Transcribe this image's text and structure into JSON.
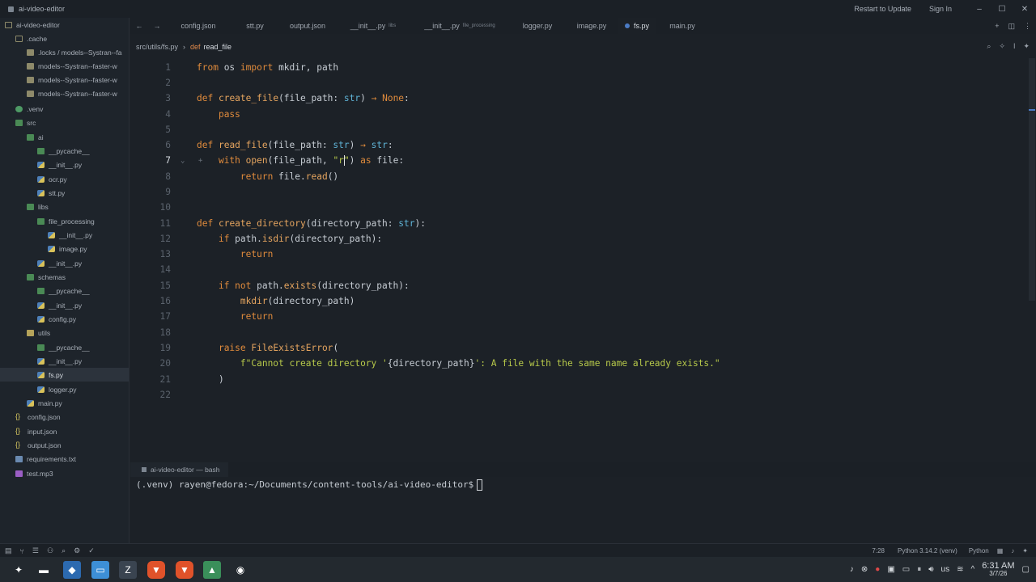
{
  "titlebar": {
    "project": "ai-video-editor",
    "restart": "Restart to Update",
    "signin": "Sign In",
    "minimize": "–",
    "maximize": "☐",
    "close": "✕"
  },
  "sidebar": {
    "root": "ai-video-editor",
    "items": [
      {
        "label": ".cache",
        "icon": "folder-open"
      },
      {
        "label": ".locks / models--Systran--fa",
        "icon": "folder"
      },
      {
        "label": "models--Systran--faster-w",
        "icon": "folder"
      },
      {
        "label": "models--Systran--faster-w",
        "icon": "folder"
      },
      {
        "label": "models--Systran--faster-w",
        "icon": "folder"
      },
      {
        "label": ".venv",
        "icon": "venv"
      },
      {
        "label": "src",
        "icon": "folder-green"
      },
      {
        "label": "ai",
        "icon": "folder-green"
      },
      {
        "label": "__pycache__",
        "icon": "folder-green"
      },
      {
        "label": "__init__.py",
        "icon": "py"
      },
      {
        "label": "ocr.py",
        "icon": "py"
      },
      {
        "label": "stt.py",
        "icon": "py"
      },
      {
        "label": "libs",
        "icon": "folder-green"
      },
      {
        "label": "file_processing",
        "icon": "folder-green"
      },
      {
        "label": "__init__.py",
        "icon": "py"
      },
      {
        "label": "image.py",
        "icon": "py"
      },
      {
        "label": "__init__.py",
        "icon": "py"
      },
      {
        "label": "schemas",
        "icon": "folder-green"
      },
      {
        "label": "__pycache__",
        "icon": "folder-green"
      },
      {
        "label": "__init__.py",
        "icon": "py"
      },
      {
        "label": "config.py",
        "icon": "py"
      },
      {
        "label": "utils",
        "icon": "folder-yellow"
      },
      {
        "label": "__pycache__",
        "icon": "folder-green"
      },
      {
        "label": "__init__.py",
        "icon": "py"
      },
      {
        "label": "fs.py",
        "icon": "py"
      },
      {
        "label": "logger.py",
        "icon": "py"
      },
      {
        "label": "main.py",
        "icon": "py"
      },
      {
        "label": "config.json",
        "icon": "json"
      },
      {
        "label": "input.json",
        "icon": "json"
      },
      {
        "label": "output.json",
        "icon": "json"
      },
      {
        "label": "requirements.txt",
        "icon": "txt"
      },
      {
        "label": "test.mp3",
        "icon": "mp3"
      }
    ]
  },
  "tabs": [
    {
      "label": "config.json",
      "sub": ""
    },
    {
      "label": "stt.py",
      "sub": ""
    },
    {
      "label": "output.json",
      "sub": ""
    },
    {
      "label": "__init__.py",
      "sub": "libs"
    },
    {
      "label": "__init__.py",
      "sub": "file_processing"
    },
    {
      "label": "logger.py",
      "sub": ""
    },
    {
      "label": "image.py",
      "sub": ""
    },
    {
      "label": "fs.py",
      "sub": ""
    },
    {
      "label": "main.py",
      "sub": ""
    }
  ],
  "breadcrumb": {
    "path": "src/utils/fs.py",
    "kw": "def",
    "fn": "read_file"
  },
  "editor": {
    "lines": [
      "1",
      "2",
      "3",
      "4",
      "5",
      "6",
      "7",
      "8",
      "9",
      "10",
      "11",
      "12",
      "13",
      "14",
      "15",
      "16",
      "17",
      "18",
      "19",
      "20",
      "21",
      "22"
    ]
  },
  "terminal": {
    "tab": "ai-video-editor — bash",
    "prompt": "(.venv) rayen@fedora:~/Documents/content-tools/ai-video-editor$"
  },
  "status": {
    "position": "7:28",
    "interpreter": "Python 3.14.2 (venv)",
    "language": "Python"
  },
  "taskbar": {
    "keyboard": "us",
    "time": "6:31 AM",
    "date": "3/7/26"
  },
  "colors": {
    "accent": "#4b7bc4",
    "keyword": "#e08b3c",
    "string": "#b7c94a",
    "type": "#5fb3d6"
  }
}
